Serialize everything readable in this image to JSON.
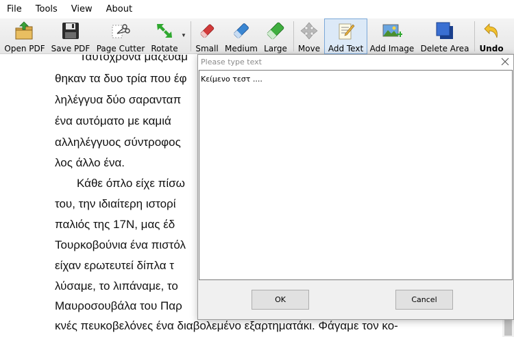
{
  "menu": [
    "File",
    "Tools",
    "View",
    "About"
  ],
  "toolbar": {
    "open_pdf": "Open PDF",
    "save_pdf": "Save PDF",
    "page_cutter": "Page Cutter",
    "rotate": "Rotate",
    "small": "Small",
    "medium": "Medium",
    "large": "Large",
    "move": "Move",
    "add_text": "Add Text",
    "add_image": "Add Image",
    "delete_area": "Delete Area",
    "undo": "Undo"
  },
  "document": {
    "lines": [
      "Ταυτόχρονα μαζεύαμ",
      "θηκαν τα δυο τρία που έφ",
      "ληλέγγυα δύο σαρανταπ",
      "ένα αυτόματο με καμιά",
      "αλληλέγγυος σύντροφος",
      "λος άλλο ένα.",
      "Κάθε όπλο είχε πίσω",
      "του, την ιδιαίτερη ιστορί",
      "παλιός της 17Ν, μας έδ",
      "Τουρκοβούνια ένα πιστόλ",
      "είχαν ερωτευτεί δίπλα τ",
      "λύσαμε, το λιπάναμε, το",
      "Μαυροσουβάλα του Παρ",
      "κνές πευκοβελόνες ένα διαβολεμένο εξαρτηματάκι. Φάγαμε τον κο-"
    ]
  },
  "dialog": {
    "title": "Please type text",
    "text_value": "Κείμενο τεστ ....",
    "ok_label": "OK",
    "cancel_label": "Cancel"
  }
}
